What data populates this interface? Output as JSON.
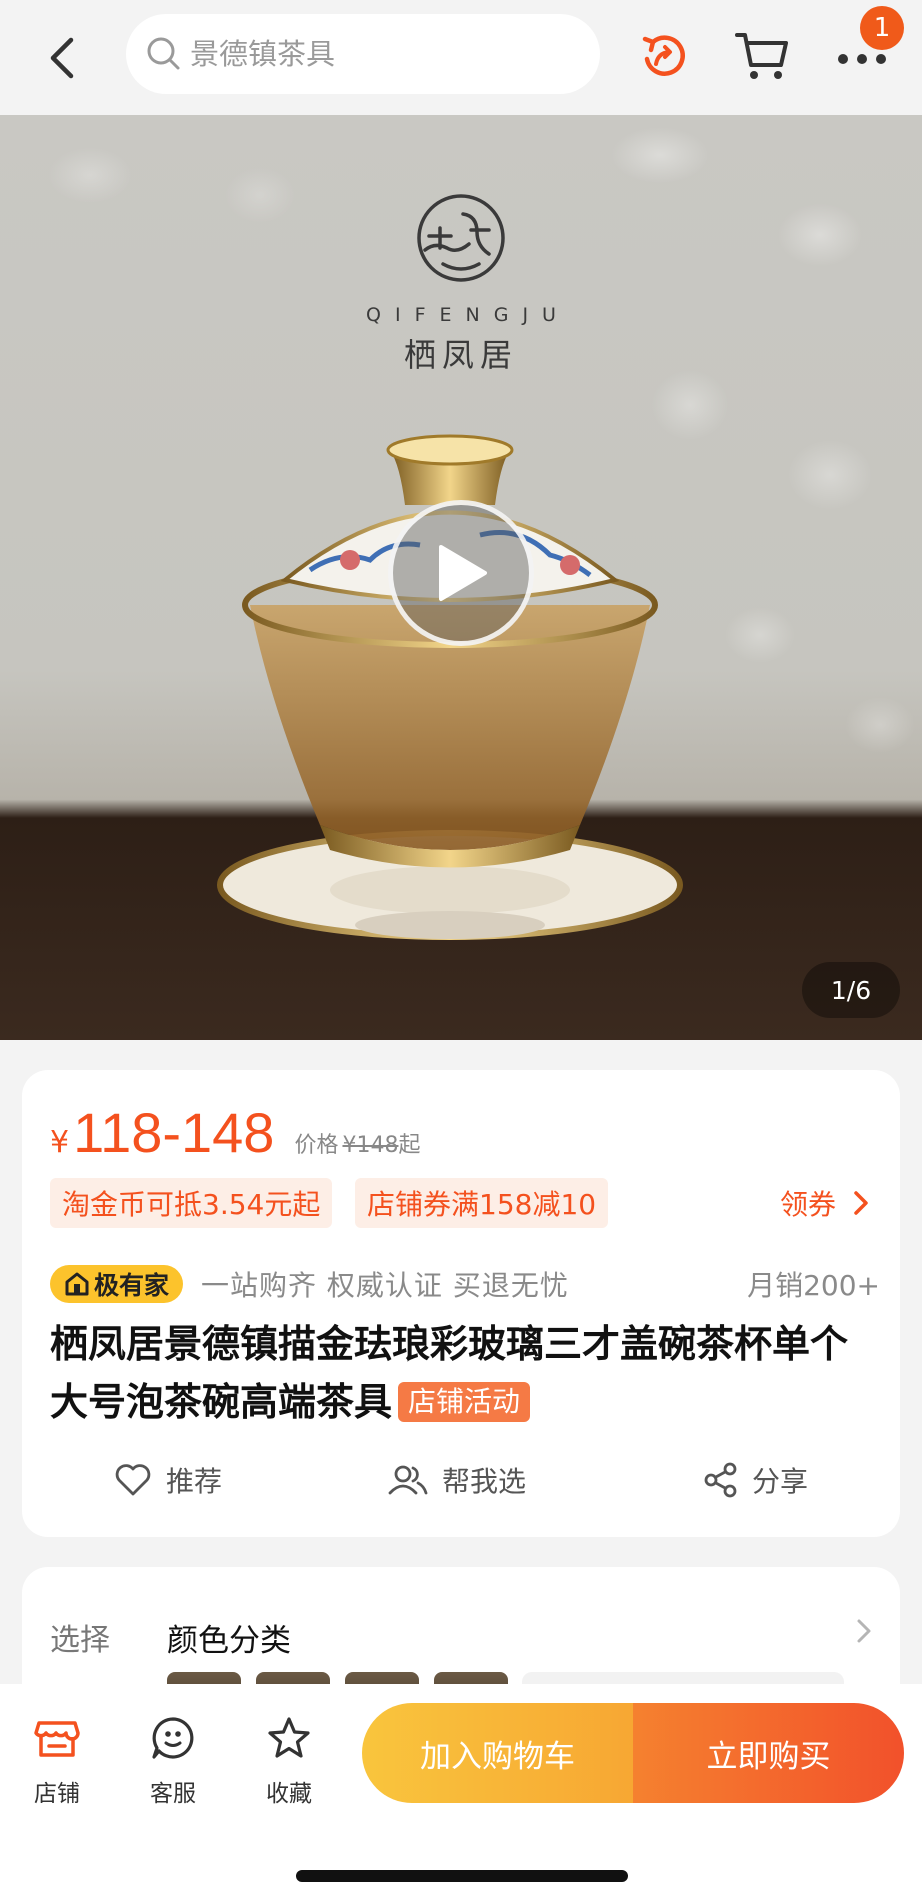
{
  "header": {
    "search_placeholder": "景德镇茶具",
    "cart_badge": "1",
    "icons": [
      "back-arrow-icon",
      "search-icon",
      "share-rotate-icon",
      "cart-icon",
      "more-icon"
    ]
  },
  "hero": {
    "brand_en": "QIFENGJU",
    "brand_cn": "栖凤居",
    "counter": "1/6"
  },
  "price": {
    "currency": "¥",
    "range": "118-148",
    "old_label": "价格",
    "old_price": "¥148",
    "old_suffix": "起",
    "chips": [
      "淘金币可抵3.54元起",
      "店铺券满158减10"
    ],
    "coupon_link": "领券",
    "badge": "极有家",
    "tagline": "一站购齐 权威认证 买退无忧",
    "sales": "月销200+",
    "title": "栖凤居景德镇描金珐琅彩玻璃三才盖碗茶杯单个大号泡茶碗高端茶具",
    "activity_tag": "店铺活动",
    "actions": [
      "推荐",
      "帮我选",
      "分享"
    ]
  },
  "spec": {
    "label": "选择",
    "value": "颜色分类"
  },
  "bottom_nav": {
    "items": [
      "店铺",
      "客服",
      "收藏"
    ],
    "add_cart": "加入购物车",
    "buy_now": "立即购买"
  },
  "colors": {
    "accent": "#f4511e",
    "yellow": "#f9c53d"
  }
}
